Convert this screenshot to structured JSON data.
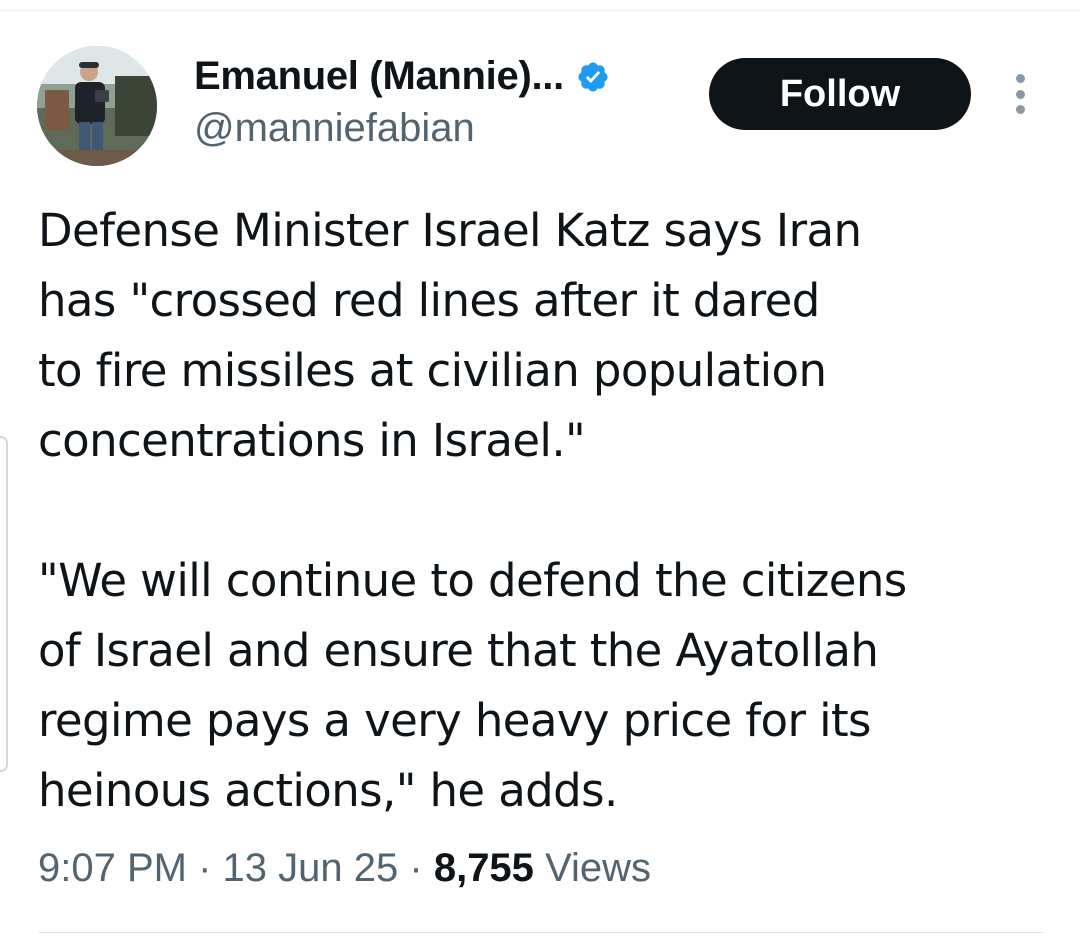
{
  "author": {
    "display_name": "Emanuel (Mannie)...",
    "handle": "@manniefabian",
    "verified": true,
    "verified_color": "#1d9bf0"
  },
  "actions": {
    "follow_label": "Follow",
    "more_icon": "more-vertical-icon"
  },
  "tweet": {
    "paragraphs": [
      {
        "lines": [
          "Defense Minister Israel Katz says Iran",
          "has \"crossed red lines after it dared",
          "to fire missiles at civilian population",
          "concentrations in Israel.\""
        ]
      },
      {
        "lines": [
          "\"We will continue to defend the citizens",
          "of Israel and ensure that the Ayatollah",
          "regime pays a very heavy price for its",
          "heinous actions,\" he adds."
        ]
      }
    ]
  },
  "meta": {
    "time": "9:07 PM",
    "separator": "·",
    "date": "13 Jun 25",
    "views_count": "8,755",
    "views_label": "Views"
  },
  "colors": {
    "text_primary": "#0f1419",
    "text_secondary": "#536471",
    "button_bg": "#0f1419",
    "button_text": "#ffffff"
  }
}
